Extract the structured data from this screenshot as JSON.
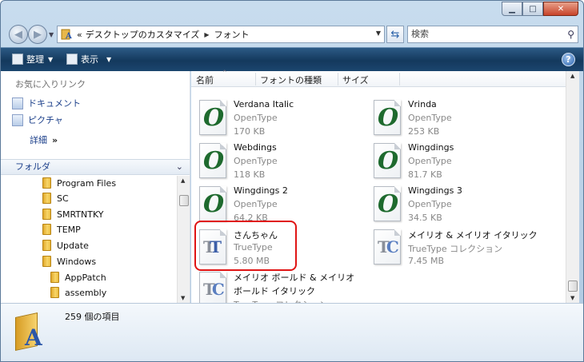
{
  "address": {
    "chevrons": "«",
    "crumbs": [
      "デスクトップのカスタマイズ",
      "フォント"
    ]
  },
  "search": {
    "placeholder": "検索"
  },
  "toolbar": {
    "organize": "整理",
    "views": "表示"
  },
  "left_pane": {
    "favorites_title": "お気に入りリンク",
    "favorites": [
      {
        "label": "ドキュメント"
      },
      {
        "label": "ピクチャ"
      }
    ],
    "more": "詳細",
    "folders_title": "フォルダ",
    "tree": [
      {
        "label": "Program Files",
        "level": 0
      },
      {
        "label": "SC",
        "level": 0
      },
      {
        "label": "SMRTNTKY",
        "level": 0
      },
      {
        "label": "TEMP",
        "level": 0
      },
      {
        "label": "Update",
        "level": 0
      },
      {
        "label": "Windows",
        "level": 0
      },
      {
        "label": "AppPatch",
        "level": 1
      },
      {
        "label": "assembly",
        "level": 1
      }
    ]
  },
  "columns": [
    "名前",
    "フォントの種類",
    "サイズ"
  ],
  "files": [
    {
      "name": "Verdana Italic",
      "type": "OpenType",
      "size": "170 KB",
      "icon": "opentype-icon"
    },
    {
      "name": "Vrinda",
      "type": "OpenType",
      "size": "253 KB",
      "icon": "opentype-icon"
    },
    {
      "name": "Webdings",
      "type": "OpenType",
      "size": "118 KB",
      "icon": "opentype-icon"
    },
    {
      "name": "Wingdings",
      "type": "OpenType",
      "size": "81.7 KB",
      "icon": "opentype-icon"
    },
    {
      "name": "Wingdings 2",
      "type": "OpenType",
      "size": "64.2 KB",
      "icon": "opentype-icon"
    },
    {
      "name": "Wingdings 3",
      "type": "OpenType",
      "size": "34.5 KB",
      "icon": "opentype-icon"
    },
    {
      "name": "さんちゃん",
      "type": "TrueType",
      "size": "5.80 MB",
      "icon": "truetype-icon",
      "highlighted": true
    },
    {
      "name": "メイリオ & メイリオ イタリック",
      "type": "TrueType コレクション",
      "size": "7.45 MB",
      "icon": "truetype-collection-icon"
    },
    {
      "name": "メイリオ ボールド & メイリオ",
      "name2": "ボールド イタリック",
      "type": "TrueType コレクション",
      "icon": "truetype-collection-icon"
    }
  ],
  "details": {
    "count_text": "259 個の項目"
  },
  "colors": {
    "command_bar": "#1b456e",
    "highlight": "#e01414"
  }
}
